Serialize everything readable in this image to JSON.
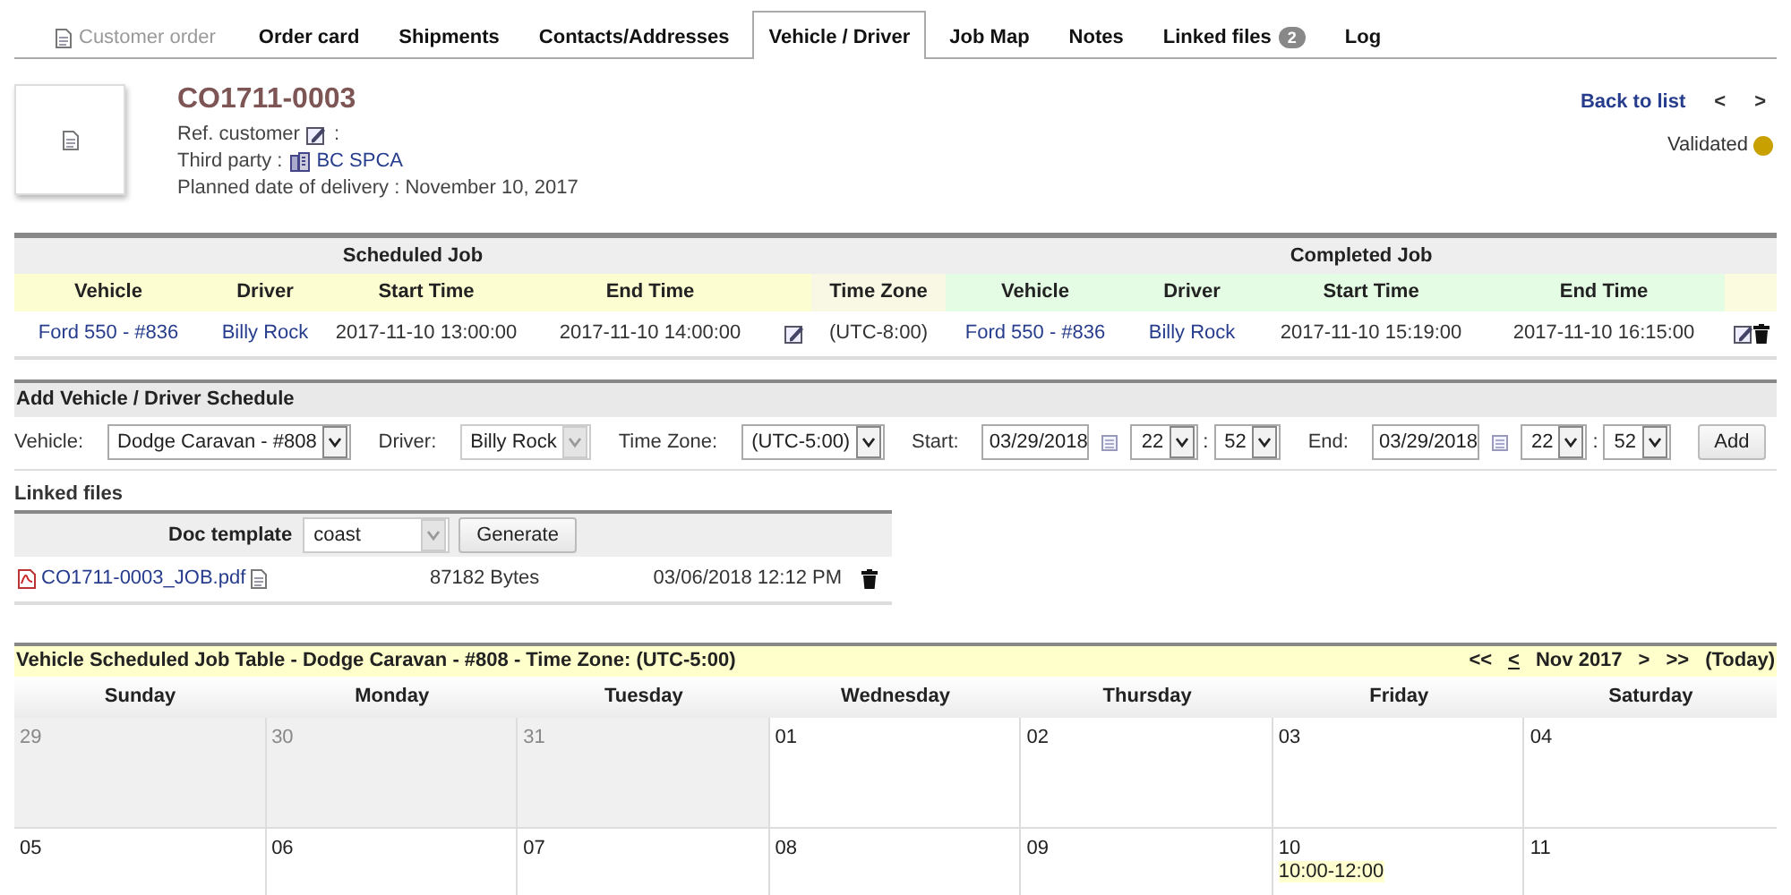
{
  "tabs": [
    {
      "label": "Customer order",
      "selected": false,
      "disabled": true
    },
    {
      "label": "Order card",
      "selected": false,
      "disabled": false
    },
    {
      "label": "Shipments",
      "selected": false,
      "disabled": false
    },
    {
      "label": "Contacts/Addresses",
      "selected": false,
      "disabled": false
    },
    {
      "label": "Vehicle / Driver",
      "selected": true,
      "disabled": false
    },
    {
      "label": "Job Map",
      "selected": false,
      "disabled": false
    },
    {
      "label": "Notes",
      "selected": false,
      "disabled": false
    },
    {
      "label": "Linked files",
      "selected": false,
      "disabled": false,
      "badge": "2"
    },
    {
      "label": "Log",
      "selected": false,
      "disabled": false
    }
  ],
  "header": {
    "ref": "CO1711-0003",
    "ref_customer_label": "Ref. customer",
    "ref_customer_colon": ":",
    "third_party_label": "Third party :",
    "third_party": "BC SPCA",
    "planned_delivery": "Planned date of delivery : November 10, 2017",
    "back_link": "Back to list",
    "prev": "<",
    "next": ">",
    "status": "Validated",
    "validated": true
  },
  "job_table": {
    "scheduled_group": "Scheduled Job",
    "completed_group": "Completed Job",
    "scheduled_columns": [
      "Vehicle",
      "Driver",
      "Start Time",
      "End Time"
    ],
    "timezone_column": "Time Zone",
    "completed_columns": [
      "Vehicle",
      "Driver",
      "Start Time",
      "End Time"
    ],
    "rows": [
      {
        "scheduled": [
          "Ford 550 - #836",
          "Billy Rock",
          "2017-11-10 13:00:00",
          "2017-11-10 14:00:00"
        ],
        "timezone": "(UTC-8:00)",
        "completed": [
          "Ford 550 - #836",
          "Billy Rock",
          "2017-11-10 15:19:00",
          "2017-11-10 16:15:00"
        ]
      }
    ]
  },
  "schedule_form": {
    "title": "Add Vehicle / Driver Schedule",
    "fields": [
      {
        "kind": "select",
        "label": "Vehicle:",
        "value": "Dodge Caravan - #808"
      },
      {
        "kind": "combo",
        "label": "Driver:",
        "value": "Billy Rock"
      },
      {
        "kind": "select",
        "label": "Time Zone:",
        "value": "(UTC-5:00)"
      },
      {
        "kind": "datetime",
        "label": "Start:",
        "date": "03/29/2018",
        "hour": "22",
        "separator": ":",
        "minute": "52"
      },
      {
        "kind": "datetime",
        "label": "End:",
        "date": "03/29/2018",
        "hour": "22",
        "separator": ":",
        "minute": "52"
      }
    ],
    "button": "Add"
  },
  "linked_files": {
    "title": "Linked files",
    "template_label": "Doc template",
    "template_value": "coast",
    "generate_button": "Generate",
    "files": [
      {
        "name": "CO1711-0003_JOB.pdf",
        "size": "87182 Bytes",
        "date": "03/06/2018 12:12 PM"
      }
    ]
  },
  "calendar": {
    "title": "Vehicle Scheduled Job Table - Dodge Caravan - #808 - Time Zone: (UTC-5:00)",
    "nav": [
      "<<",
      "<",
      "Nov 2017",
      ">",
      ">>",
      "(Today)"
    ],
    "days": [
      "Sunday",
      "Monday",
      "Tuesday",
      "Wednesday",
      "Thursday",
      "Friday",
      "Saturday"
    ],
    "weeks": [
      [
        {
          "day": "29",
          "outside": true
        },
        {
          "day": "30",
          "outside": true
        },
        {
          "day": "31",
          "outside": true
        },
        {
          "day": "01",
          "outside": false
        },
        {
          "day": "02",
          "outside": false
        },
        {
          "day": "03",
          "outside": false
        },
        {
          "day": "04",
          "outside": false
        }
      ],
      [
        {
          "day": "05",
          "outside": false
        },
        {
          "day": "06",
          "outside": false
        },
        {
          "day": "07",
          "outside": false
        },
        {
          "day": "08",
          "outside": false
        },
        {
          "day": "09",
          "outside": false
        },
        {
          "day": "10",
          "outside": false,
          "events": [
            "10:00-12:00"
          ]
        },
        {
          "day": "11",
          "outside": false
        }
      ]
    ]
  }
}
